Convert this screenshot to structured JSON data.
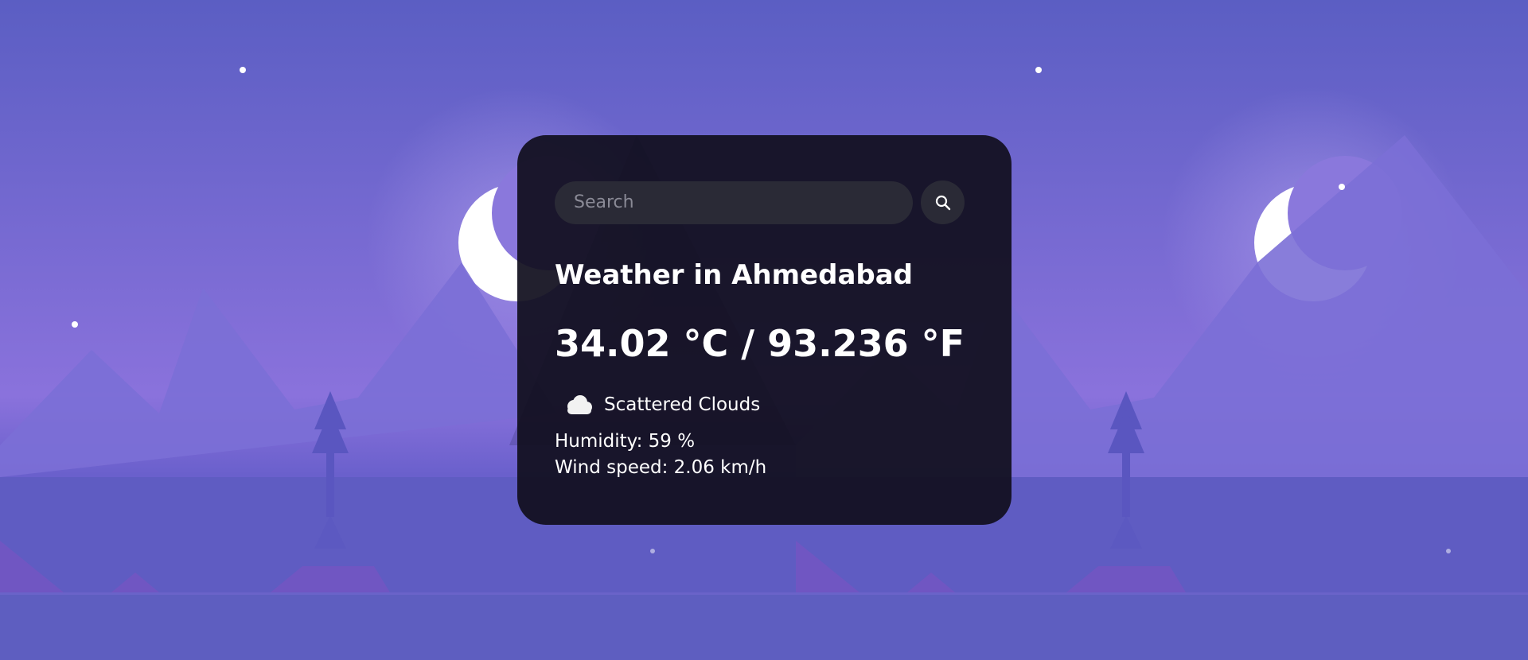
{
  "search": {
    "placeholder": "Search"
  },
  "weather": {
    "title": "Weather in Ahmedabad",
    "temperature": "34.02 °C / 93.236 °F",
    "description": "Scattered Clouds",
    "description_icon": "cloud-icon",
    "humidity": "Humidity: 59 %",
    "wind": "Wind speed: 2.06 km/h"
  },
  "colors": {
    "sky_top": "#5d5dc1",
    "sky_glow": "#8b72dc",
    "mountain": "#7a6fd6",
    "card_bg": "#110f1e",
    "field_bg": "#2a2a36"
  }
}
